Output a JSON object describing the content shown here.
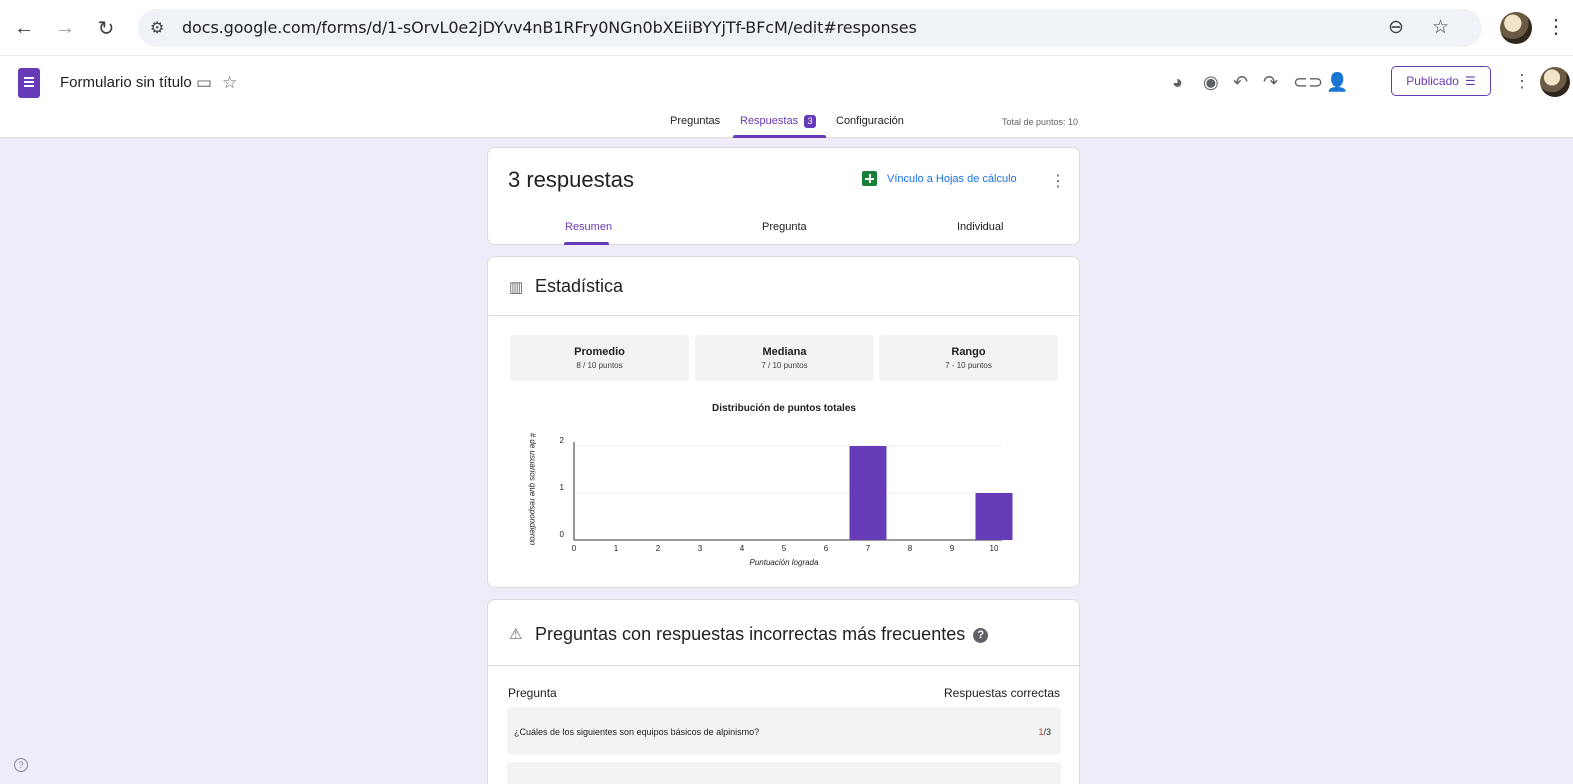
{
  "browser": {
    "url": "docs.google.com/forms/d/1-sOrvL0e2jDYvv4nB1RFry0NGn0bXEiiBYYjTf-BFcM/edit#responses",
    "icons": [
      "back-icon",
      "forward-icon",
      "reload-icon",
      "site-settings-icon",
      "zoom-icon",
      "bookmark-star-icon",
      "profile-avatar",
      "chrome-menu-icon"
    ]
  },
  "header": {
    "form_title": "Formulario sin título",
    "publish_label": "Publicado",
    "tools": [
      "palette-icon",
      "preview-eye-icon",
      "undo-icon",
      "redo-icon",
      "link-icon",
      "add-collaborator-icon"
    ]
  },
  "tabs": {
    "preguntas": "Preguntas",
    "respuestas": "Respuestas",
    "respuestas_badge": "3",
    "configuracion": "Configuración",
    "total_points": "Total de puntos: 10"
  },
  "responses_card": {
    "count_label": "3 respuestas",
    "sheets_link": "Vínculo a Hojas de cálculo",
    "subtabs": [
      "Resumen",
      "Pregunta",
      "Individual"
    ],
    "active_subtab": "Resumen"
  },
  "stats_card": {
    "title": "Estadística",
    "stats": [
      {
        "label": "Promedio",
        "value": "8 / 10 puntos"
      },
      {
        "label": "Mediana",
        "value": "7 / 10 puntos"
      },
      {
        "label": "Rango",
        "value": "7 - 10 puntos"
      }
    ]
  },
  "chart_data": {
    "type": "bar",
    "title": "Distribución de puntos totales",
    "xlabel": "Puntuación lograda",
    "ylabel": "# de usuarios que respondieron",
    "x": [
      0,
      1,
      2,
      3,
      4,
      5,
      6,
      7,
      8,
      9,
      10
    ],
    "values": [
      0,
      0,
      0,
      0,
      0,
      0,
      0,
      2,
      0,
      0,
      1
    ],
    "ylim": [
      0,
      2
    ],
    "yticks": [
      0,
      1,
      2
    ],
    "color": "#673ab7",
    "grid": true
  },
  "questions_card": {
    "title": "Preguntas con respuestas incorrectas más frecuentes",
    "col_question": "Pregunta",
    "col_correct": "Respuestas correctas",
    "rows": [
      {
        "question": "¿Cuáles de los siguientes son equipos básicos de alpinismo?",
        "correct": "1",
        "total": "/3"
      }
    ]
  },
  "colors": {
    "accent": "#673ab7",
    "background": "#f0ebf8",
    "link": "#1a73e8",
    "error": "#d93025"
  }
}
